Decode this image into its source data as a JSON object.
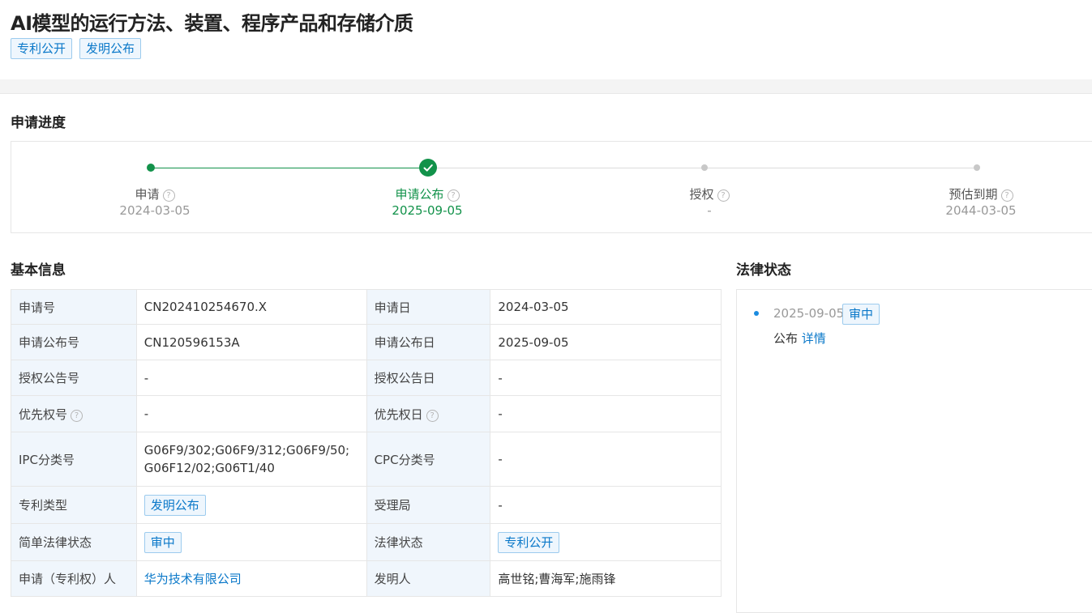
{
  "header": {
    "title": "AI模型的运行方法、装置、程序产品和存储介质",
    "tags": [
      "专利公开",
      "发明公布"
    ]
  },
  "progress": {
    "section_title": "申请进度",
    "steps": [
      {
        "label": "申请",
        "date": "2024-03-05",
        "state": "done"
      },
      {
        "label": "申请公布",
        "date": "2025-09-05",
        "state": "current"
      },
      {
        "label": "授权",
        "date": "-",
        "state": "pending"
      },
      {
        "label": "预估到期",
        "date": "2044-03-05",
        "state": "pending"
      }
    ],
    "help_glyph": "?"
  },
  "basic_info": {
    "section_title": "基本信息",
    "rows": [
      {
        "k1": "申请号",
        "v1": "CN202410254670.X",
        "k2": "申请日",
        "v2": "2024-03-05"
      },
      {
        "k1": "申请公布号",
        "v1": "CN120596153A",
        "k2": "申请公布日",
        "v2": "2025-09-05"
      },
      {
        "k1": "授权公告号",
        "v1": "-",
        "k2": "授权公告日",
        "v2": "-"
      },
      {
        "k1": "优先权号",
        "v1": "-",
        "k2": "优先权日",
        "v2": "-"
      },
      {
        "k1": "IPC分类号",
        "v1": "G06F9/302;G06F9/312;G06F9/50;G06F12/02;G06T1/40",
        "k2": "CPC分类号",
        "v2": "-"
      },
      {
        "k1": "专利类型",
        "v1": "发明公布",
        "k2": "受理局",
        "v2": "-"
      },
      {
        "k1": "简单法律状态",
        "v1": "审中",
        "k2": "法律状态",
        "v2": "专利公开"
      },
      {
        "k1": "申请（专利权）人",
        "v1": "华为技术有限公司",
        "k2": "发明人",
        "v2": "高世铭;曹海军;施雨锋"
      }
    ]
  },
  "legal_status": {
    "section_title": "法律状态",
    "events": [
      {
        "date": "2025-09-05",
        "badge": "审中",
        "desc": "公布",
        "link": "详情"
      }
    ]
  },
  "colors": {
    "accent": "#0a78c9",
    "success": "#12924a",
    "pending": "#c8c8c8"
  }
}
